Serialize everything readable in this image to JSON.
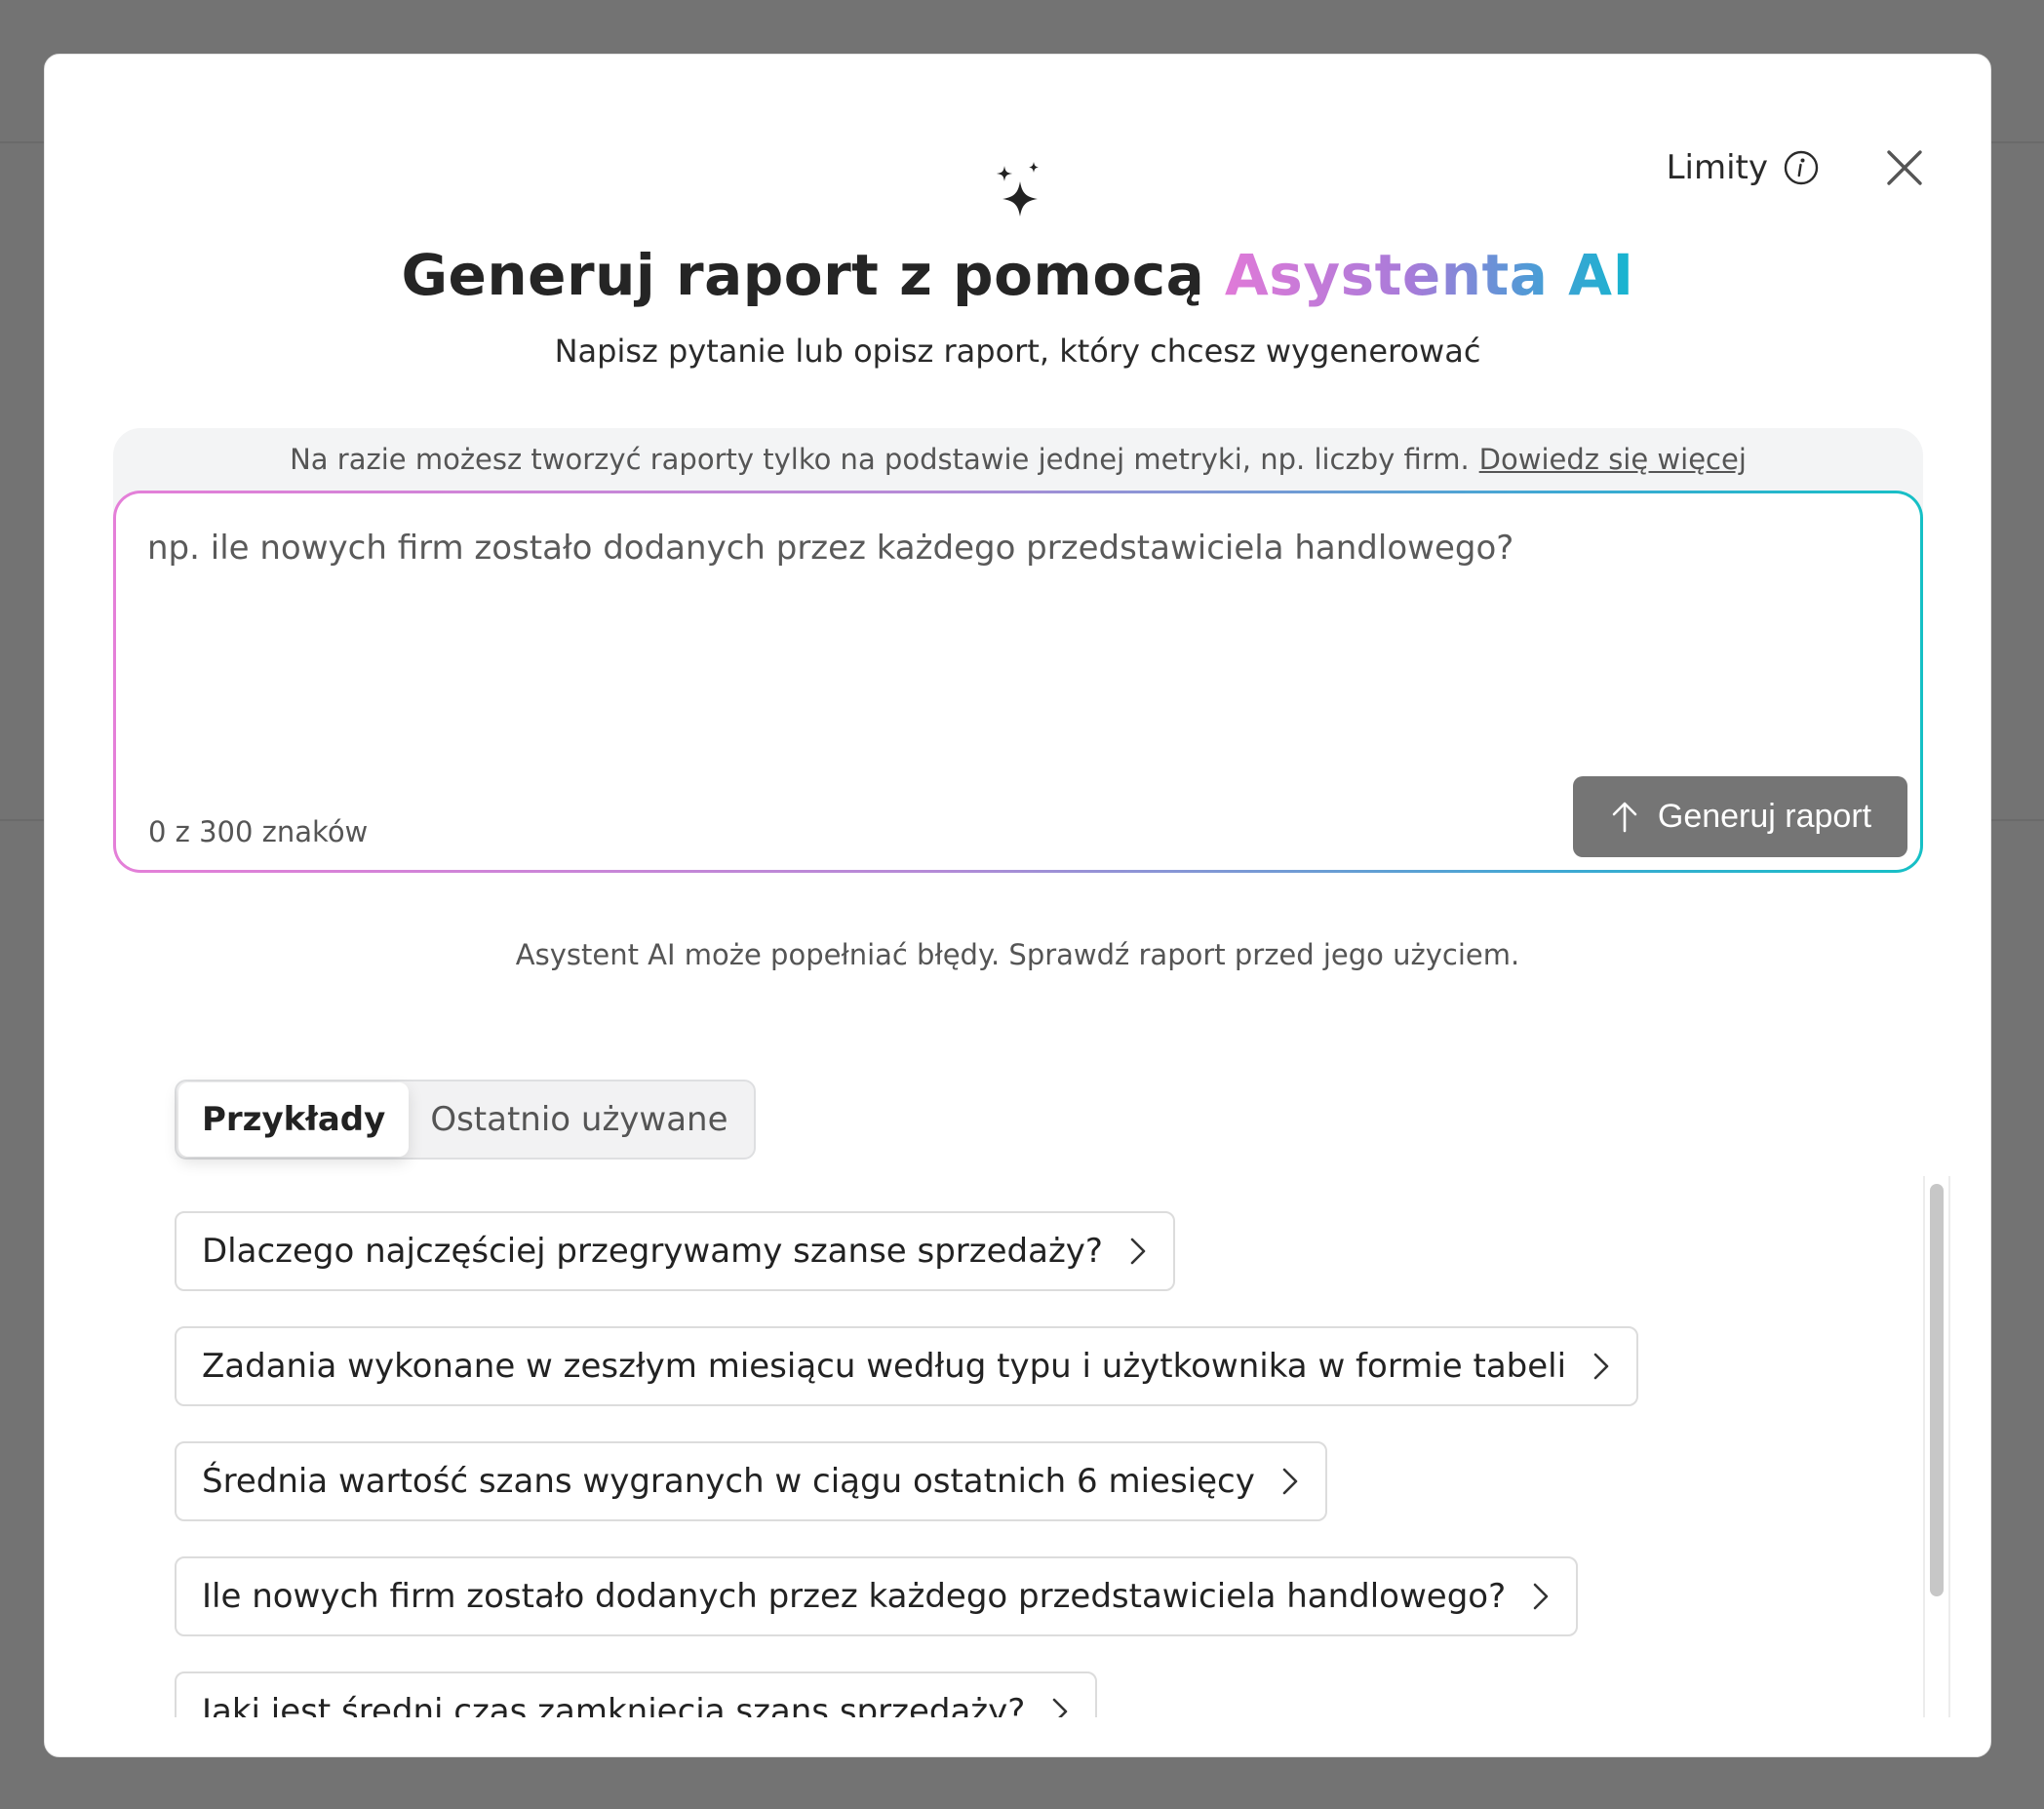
{
  "header": {
    "limits_label": "Limity",
    "limits_icon": "info-icon",
    "close_icon": "close-icon"
  },
  "hero": {
    "icon": "sparkles-icon",
    "title_main": "Generuj raport z pomocą ",
    "title_ai": "Asystenta AI",
    "subtitle": "Napisz pytanie lub opisz raport, który chcesz wygenerować"
  },
  "notice": {
    "text": "Na razie możesz tworzyć raporty tylko na podstawie jednej metryki, np. liczby firm.",
    "link": "Dowiedz się więcej"
  },
  "composer": {
    "value": "",
    "placeholder": "np. ile nowych firm zostało dodanych przez każdego przedstawiciela handlowego?",
    "counter": "0 z 300 znaków",
    "submit_label": "Generuj raport",
    "submit_icon": "arrow-up-icon"
  },
  "disclaimer": "Asystent AI może popełniać błędy. Sprawdź raport przed jego użyciem.",
  "tabs": [
    {
      "label": "Przykłady",
      "active": true
    },
    {
      "label": "Ostatnio używane",
      "active": false
    }
  ],
  "examples": [
    "Dlaczego najczęściej przegrywamy szanse sprzedaży?",
    "Zadania wykonane w zeszłym miesiącu według typu i użytkownika w formie tabeli",
    "Średnia wartość szans wygranych w ciągu ostatnich 6 miesięcy",
    "Ile nowych firm zostało dodanych przez każdego przedstawiciela handlowego?",
    "Jaki jest średni czas zamknięcia szans sprzedaży?"
  ],
  "colors": {
    "ai_gradient_start": "#e07ad8",
    "ai_gradient_end": "#14b6cf",
    "submit_button": "#757575",
    "overlay": "#737373"
  }
}
